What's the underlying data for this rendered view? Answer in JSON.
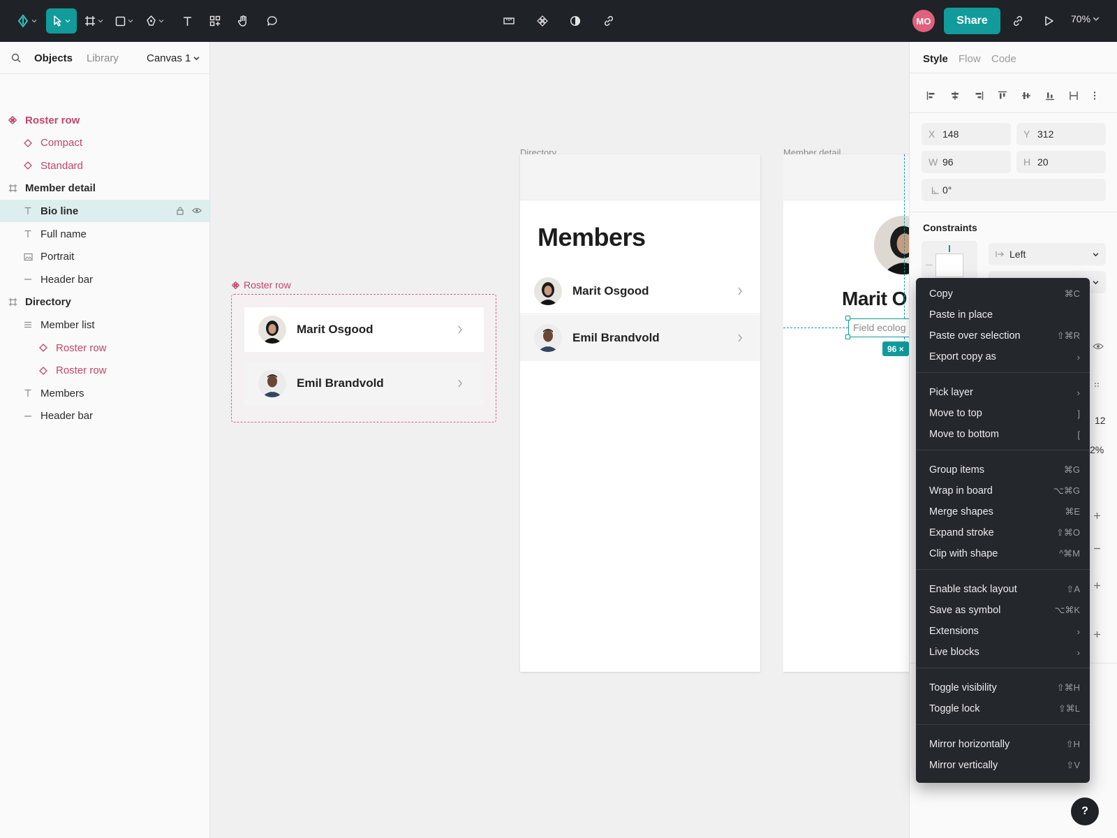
{
  "toolbar": {
    "share_label": "Share",
    "avatar_initials": "MO",
    "zoom_label": "70%"
  },
  "left_panel": {
    "tabs": [
      "Objects",
      "Library"
    ],
    "canvas_selector": "Canvas 1",
    "layers": [
      {
        "label": "Roster row",
        "icon": "component-icon",
        "depth": 0,
        "kind": "component"
      },
      {
        "label": "Compact",
        "icon": "variant-icon",
        "depth": 1,
        "kind": "component"
      },
      {
        "label": "Standard",
        "icon": "variant-icon",
        "depth": 1,
        "kind": "component"
      },
      {
        "label": "Member detail",
        "icon": "board-icon",
        "depth": 0,
        "kind": "board"
      },
      {
        "label": "Bio line",
        "icon": "text-icon",
        "depth": 1,
        "kind": "selected"
      },
      {
        "label": "Full name",
        "icon": "text-icon",
        "depth": 1,
        "kind": "normal"
      },
      {
        "label": "Portrait",
        "icon": "image-icon",
        "depth": 1,
        "kind": "normal"
      },
      {
        "label": "Header bar",
        "icon": "line-icon",
        "depth": 1,
        "kind": "normal"
      },
      {
        "label": "Directory",
        "icon": "board-icon",
        "depth": 0,
        "kind": "board"
      },
      {
        "label": "Member list",
        "icon": "list-icon",
        "depth": 1,
        "kind": "normal"
      },
      {
        "label": "Roster row",
        "icon": "variant-icon",
        "depth": 2,
        "kind": "component"
      },
      {
        "label": "Roster row",
        "icon": "variant-icon",
        "depth": 2,
        "kind": "component"
      },
      {
        "label": "Members",
        "icon": "text-icon",
        "depth": 1,
        "kind": "normal"
      },
      {
        "label": "Header bar",
        "icon": "line-icon",
        "depth": 1,
        "kind": "normal"
      }
    ]
  },
  "canvas": {
    "component_label": "Roster row",
    "component_rows": [
      "Marit Osgood",
      "Emil Brandvold"
    ],
    "directory": {
      "label": "Directory",
      "title": "Members",
      "rows": [
        "Marit Osgood",
        "Emil Brandvold"
      ]
    },
    "detail": {
      "label": "Member detail",
      "name": "Marit O",
      "field_text": "Field ecolog",
      "size_badge": "96 ×"
    }
  },
  "right_panel": {
    "tabs": [
      "Style",
      "Flow",
      "Code"
    ],
    "x_label": "X",
    "x": "148",
    "y_label": "Y",
    "y": "312",
    "w_label": "W",
    "w": "96",
    "h_label": "H",
    "h": "20",
    "rotation": "0°",
    "constraints_label": "Constraints",
    "constraint_h": "Left",
    "peek_values": [
      "12",
      "2%"
    ]
  },
  "context_menu": {
    "groups": [
      [
        {
          "label": "Copy",
          "shortcut": "⌘C"
        },
        {
          "label": "Paste in place",
          "shortcut": ""
        },
        {
          "label": "Paste over selection",
          "shortcut": "⇧⌘R"
        },
        {
          "label": "Export copy as",
          "shortcut": "›"
        }
      ],
      [
        {
          "label": "Pick layer",
          "shortcut": "›"
        },
        {
          "label": "Move to top",
          "shortcut": "]"
        },
        {
          "label": "Move to bottom",
          "shortcut": "["
        }
      ],
      [
        {
          "label": "Group items",
          "shortcut": "⌘G"
        },
        {
          "label": "Wrap in board",
          "shortcut": "⌥⌘G"
        },
        {
          "label": "Merge shapes",
          "shortcut": "⌘E"
        },
        {
          "label": "Expand stroke",
          "shortcut": "⇧⌘O"
        },
        {
          "label": "Clip with shape",
          "shortcut": "^⌘M"
        }
      ],
      [
        {
          "label": "Enable stack layout",
          "shortcut": "⇧A"
        },
        {
          "label": "Save as symbol",
          "shortcut": "⌥⌘K"
        },
        {
          "label": "Extensions",
          "shortcut": "›"
        },
        {
          "label": "Live blocks",
          "shortcut": "›"
        }
      ],
      [
        {
          "label": "Toggle visibility",
          "shortcut": "⇧⌘H"
        },
        {
          "label": "Toggle lock",
          "shortcut": "⇧⌘L"
        }
      ],
      [
        {
          "label": "Mirror horizontally",
          "shortcut": "⇧H"
        },
        {
          "label": "Mirror vertically",
          "shortcut": "⇧V"
        }
      ]
    ]
  },
  "help_label": "?",
  "colors": {
    "accent": "#119b9b",
    "component": "#c2456b",
    "toolbar_bg": "#1f2227",
    "menu_bg": "#24272c"
  }
}
